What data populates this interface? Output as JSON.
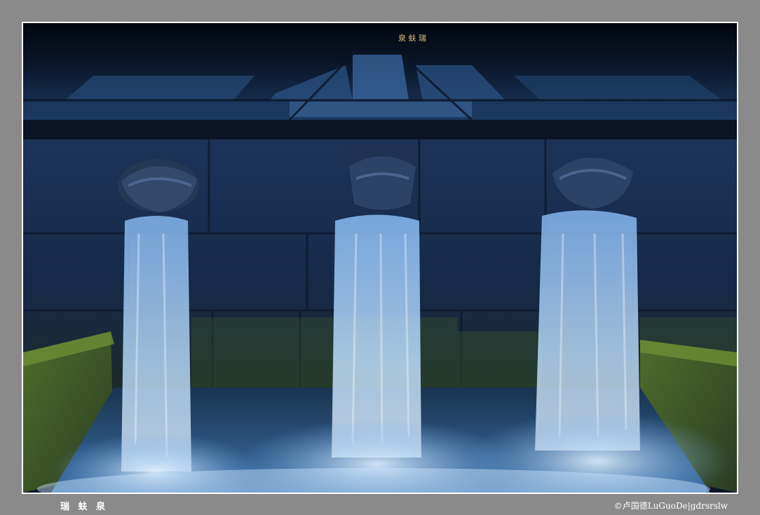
{
  "photo": {
    "subject": "three-spouts-fountain",
    "sign_text": "泉 蚨 瑞",
    "caption_title": "瑞 蚨 泉",
    "copyright": "©卢国德LuGuoDe|gdrsrslw"
  },
  "colors": {
    "background": "#8a8a8a",
    "frame": "#ffffff",
    "night_sky": "#0a1526",
    "stone": "#1b2c48",
    "water": "#cfe7ff",
    "moss": "#5c7a2e"
  }
}
